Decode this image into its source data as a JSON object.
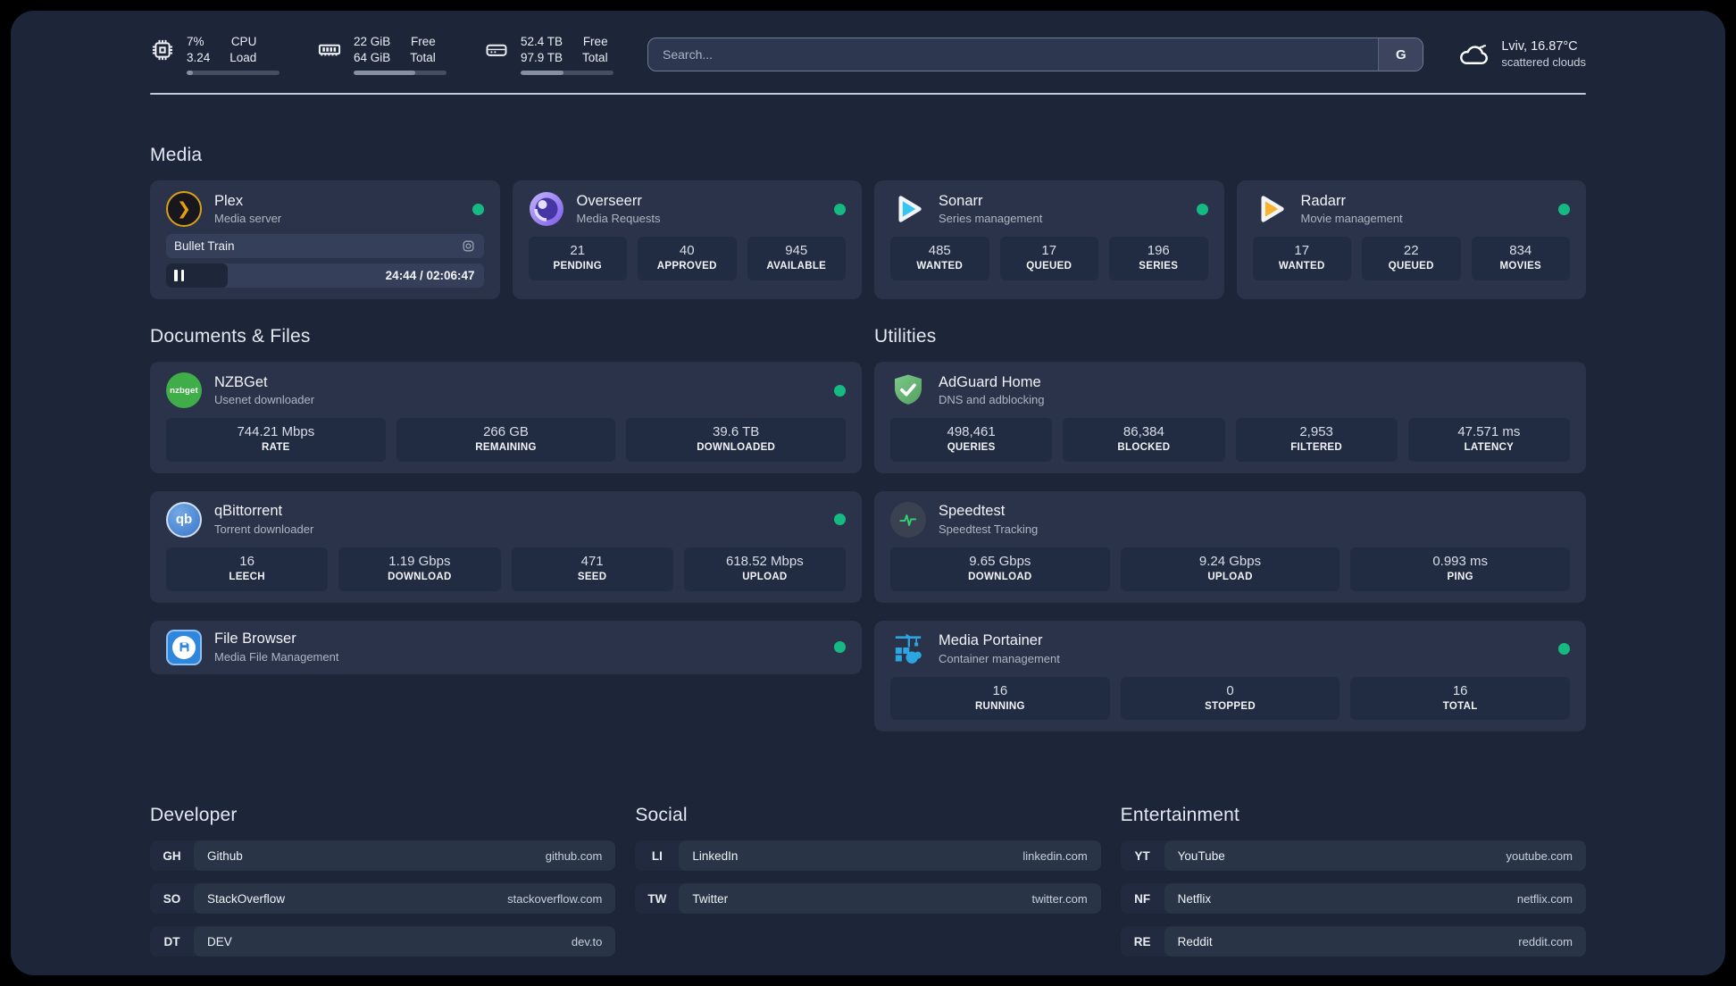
{
  "colors": {
    "background": "#1d2538",
    "card": "#2a3349",
    "tile": "#212b42",
    "status_online": "#16b981",
    "plex_gold": "#e5a00d",
    "sonarr_blue": "#35c5f4",
    "radarr_gold": "#f7b32b",
    "adguard_green": "#67b279",
    "portainer_blue": "#2ca6e0"
  },
  "header": {
    "system": [
      {
        "icon": "cpu-icon",
        "value_top": "7%",
        "value_bottom": "3.24",
        "label_top": "CPU",
        "label_bottom": "Load",
        "progress": 7
      },
      {
        "icon": "ram-icon",
        "value_top": "22 GiB",
        "value_bottom": "64 GiB",
        "label_top": "Free",
        "label_bottom": "Total",
        "progress": 66
      },
      {
        "icon": "disk-icon",
        "value_top": "52.4 TB",
        "value_bottom": "97.9 TB",
        "label_top": "Free",
        "label_bottom": "Total",
        "progress": 46
      }
    ],
    "search": {
      "placeholder": "Search...",
      "engine_button": "G"
    },
    "weather": {
      "icon": "cloud-icon",
      "title": "Lviv, 16.87°C",
      "subtitle": "scattered clouds"
    }
  },
  "sections": {
    "media": {
      "heading": "Media",
      "cards": [
        {
          "title": "Plex",
          "subtitle": "Media server",
          "status": "online",
          "player": {
            "track": "Bullet Train",
            "time": "24:44 / 02:06:47",
            "progress": 19.5
          }
        },
        {
          "title": "Overseerr",
          "subtitle": "Media Requests",
          "status": "online",
          "stats": [
            {
              "value": "21",
              "label": "PENDING"
            },
            {
              "value": "40",
              "label": "APPROVED"
            },
            {
              "value": "945",
              "label": "AVAILABLE"
            }
          ]
        },
        {
          "title": "Sonarr",
          "subtitle": "Series management",
          "status": "online",
          "stats": [
            {
              "value": "485",
              "label": "WANTED"
            },
            {
              "value": "17",
              "label": "QUEUED"
            },
            {
              "value": "196",
              "label": "SERIES"
            }
          ]
        },
        {
          "title": "Radarr",
          "subtitle": "Movie management",
          "status": "online",
          "stats": [
            {
              "value": "17",
              "label": "WANTED"
            },
            {
              "value": "22",
              "label": "QUEUED"
            },
            {
              "value": "834",
              "label": "MOVIES"
            }
          ]
        }
      ]
    },
    "documents": {
      "heading": "Documents & Files",
      "cards": [
        {
          "title": "NZBGet",
          "subtitle": "Usenet downloader",
          "status": "online",
          "stats": [
            {
              "value": "744.21 Mbps",
              "label": "RATE"
            },
            {
              "value": "266 GB",
              "label": "REMAINING"
            },
            {
              "value": "39.6 TB",
              "label": "DOWNLOADED"
            }
          ]
        },
        {
          "title": "qBittorrent",
          "subtitle": "Torrent downloader",
          "status": "online",
          "stats": [
            {
              "value": "16",
              "label": "LEECH"
            },
            {
              "value": "1.19 Gbps",
              "label": "DOWNLOAD"
            },
            {
              "value": "471",
              "label": "SEED"
            },
            {
              "value": "618.52 Mbps",
              "label": "UPLOAD"
            }
          ]
        },
        {
          "title": "File Browser",
          "subtitle": "Media File Management",
          "status": "online",
          "stats": []
        }
      ]
    },
    "utilities": {
      "heading": "Utilities",
      "cards": [
        {
          "title": "AdGuard Home",
          "subtitle": "DNS and adblocking",
          "stats": [
            {
              "value": "498,461",
              "label": "QUERIES"
            },
            {
              "value": "86,384",
              "label": "BLOCKED"
            },
            {
              "value": "2,953",
              "label": "FILTERED"
            },
            {
              "value": "47.571 ms",
              "label": "LATENCY"
            }
          ]
        },
        {
          "title": "Speedtest",
          "subtitle": "Speedtest Tracking",
          "stats": [
            {
              "value": "9.65 Gbps",
              "label": "DOWNLOAD"
            },
            {
              "value": "9.24 Gbps",
              "label": "UPLOAD"
            },
            {
              "value": "0.993 ms",
              "label": "PING"
            }
          ]
        },
        {
          "title": "Media Portainer",
          "subtitle": "Container management",
          "status": "online",
          "stats": [
            {
              "value": "16",
              "label": "RUNNING"
            },
            {
              "value": "0",
              "label": "STOPPED"
            },
            {
              "value": "16",
              "label": "TOTAL"
            }
          ]
        }
      ]
    }
  },
  "bookmarks": [
    {
      "heading": "Developer",
      "links": [
        {
          "abbr": "GH",
          "name": "Github",
          "url": "github.com"
        },
        {
          "abbr": "SO",
          "name": "StackOverflow",
          "url": "stackoverflow.com"
        },
        {
          "abbr": "DT",
          "name": "DEV",
          "url": "dev.to"
        }
      ]
    },
    {
      "heading": "Social",
      "links": [
        {
          "abbr": "LI",
          "name": "LinkedIn",
          "url": "linkedin.com"
        },
        {
          "abbr": "TW",
          "name": "Twitter",
          "url": "twitter.com"
        }
      ]
    },
    {
      "heading": "Entertainment",
      "links": [
        {
          "abbr": "YT",
          "name": "YouTube",
          "url": "youtube.com"
        },
        {
          "abbr": "NF",
          "name": "Netflix",
          "url": "netflix.com"
        },
        {
          "abbr": "RE",
          "name": "Reddit",
          "url": "reddit.com"
        }
      ]
    }
  ]
}
